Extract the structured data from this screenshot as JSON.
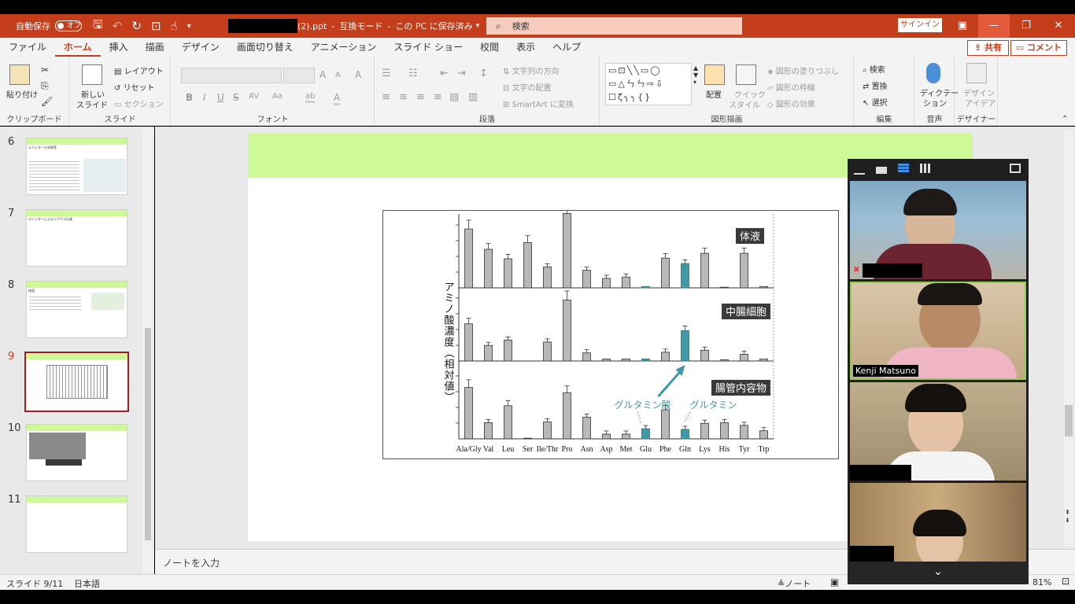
{
  "titlebar": {
    "autosave_label": "自動保存",
    "autosave_state": "オフ",
    "doc_suffix": "(2).ppt",
    "mode": "互換モード",
    "save_state": "この PC に保存済み",
    "search_placeholder": "検索",
    "signin": "サインイン"
  },
  "menu": {
    "items": [
      "ファイル",
      "ホーム",
      "挿入",
      "描画",
      "デザイン",
      "画面切り替え",
      "アニメーション",
      "スライド ショー",
      "校閲",
      "表示",
      "ヘルプ"
    ],
    "active": "ホーム",
    "share": "共有",
    "comment": "コメント"
  },
  "ribbon": {
    "clipboard": {
      "label": "クリップボード",
      "paste": "貼り付け"
    },
    "slides": {
      "label": "スライド",
      "new_slide_1": "新しい",
      "new_slide_2": "スライド",
      "layout": "レイアウト",
      "reset": "リセット",
      "section": "セクション"
    },
    "font": {
      "label": "フォント",
      "bold": "B",
      "italic": "I",
      "underline": "U",
      "strike": "S",
      "spacing": "AV",
      "case": "Aa",
      "grow": "A",
      "shrink": "A",
      "clear": "A",
      "highlight": "ab",
      "color": "A"
    },
    "paragraph": {
      "label": "段落",
      "direction": "文字列の方向",
      "align": "文字の配置",
      "smartart": "SmartArt に変換"
    },
    "drawing": {
      "label": "図形描画",
      "arrange": "配置",
      "quickstyle_1": "クイック",
      "quickstyle_2": "スタイル",
      "fill": "図形の塗りつぶし",
      "outline": "図形の枠線",
      "effects": "図形の効果"
    },
    "editing": {
      "label": "編集",
      "find": "検索",
      "replace": "置換",
      "select": "選択"
    },
    "voice": {
      "label": "音声",
      "dictate_1": "ディクテー",
      "dictate_2": "ション"
    },
    "designer": {
      "label": "デザイナー",
      "ideas_1": "デザイン",
      "ideas_2": "アイデア"
    }
  },
  "thumbnails": [
    {
      "num": "6",
      "title": "エリシターの効果等"
    },
    {
      "num": "7",
      "title": "エリシターによるシグナル伝達"
    },
    {
      "num": "8",
      "title": "結語"
    },
    {
      "num": "9",
      "title": ""
    },
    {
      "num": "10",
      "title": ""
    },
    {
      "num": "11",
      "title": ""
    }
  ],
  "current_slide_index": 3,
  "notes_placeholder": "ノートを入力",
  "status": {
    "slide": "スライド 9/11",
    "language": "日本語",
    "notes": "ノート",
    "zoom": "81%"
  },
  "chart_data": {
    "type": "bar",
    "ylabel": "アミノ酸濃度（相対値）",
    "categories": [
      "Ala/Gly",
      "Val",
      "Leu",
      "Ser",
      "Ile/Thr",
      "Pro",
      "Asn",
      "Asp",
      "Met",
      "Glu",
      "Phe",
      "Gln",
      "Lys",
      "His",
      "Tyr",
      "Trp"
    ],
    "highlight_categories": [
      "Glu",
      "Gln"
    ],
    "highlight_color": "#3f9aa6",
    "panels": [
      {
        "name": "体液",
        "values": [
          0.87,
          0.57,
          0.43,
          0.67,
          0.31,
          1.1,
          0.26,
          0.14,
          0.16,
          0.02,
          0.44,
          0.36,
          0.51,
          0.01,
          0.51,
          0.02
        ]
      },
      {
        "name": "中腸細胞",
        "values": [
          0.55,
          0.23,
          0.31,
          0.0,
          0.28,
          0.9,
          0.12,
          0.03,
          0.03,
          0.03,
          0.13,
          0.45,
          0.16,
          0.02,
          0.1,
          0.03
        ]
      },
      {
        "name": "腸管内容物",
        "values": [
          0.76,
          0.24,
          0.49,
          0.01,
          0.25,
          0.68,
          0.32,
          0.07,
          0.07,
          0.15,
          0.43,
          0.14,
          0.23,
          0.24,
          0.2,
          0.12
        ]
      }
    ],
    "annotations": [
      "グルタミン酸",
      "グルタミン"
    ]
  },
  "zoom_participants": [
    {
      "name": "",
      "muted": true
    },
    {
      "name": "Kenji Matsuno",
      "muted": false,
      "active_speaker": true
    },
    {
      "name": "",
      "muted": false
    },
    {
      "name": "",
      "muted": false
    }
  ]
}
